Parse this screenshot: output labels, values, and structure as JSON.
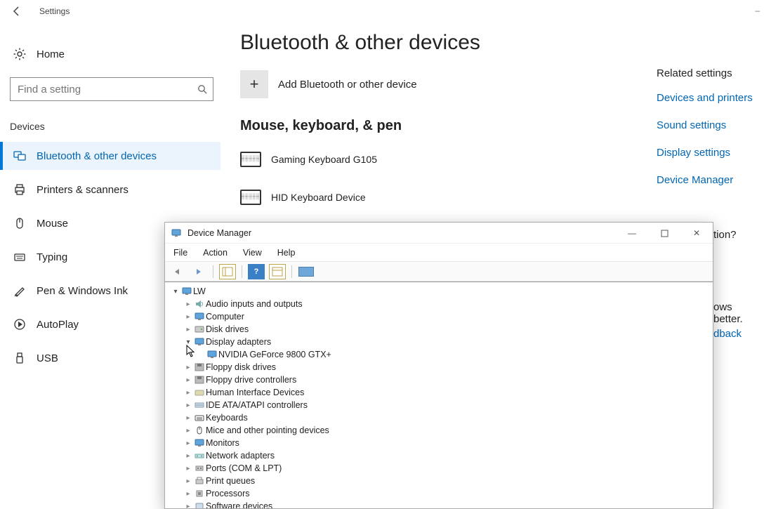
{
  "titlebar": {
    "label": "Settings"
  },
  "home": {
    "label": "Home"
  },
  "search": {
    "placeholder": "Find a setting"
  },
  "nav_group_label": "Devices",
  "nav": [
    {
      "label": "Bluetooth & other devices",
      "icon": "bluetooth-devices-icon"
    },
    {
      "label": "Printers & scanners",
      "icon": "printer-icon"
    },
    {
      "label": "Mouse",
      "icon": "mouse-icon"
    },
    {
      "label": "Typing",
      "icon": "typing-icon"
    },
    {
      "label": "Pen & Windows Ink",
      "icon": "pen-icon"
    },
    {
      "label": "AutoPlay",
      "icon": "autoplay-icon"
    },
    {
      "label": "USB",
      "icon": "usb-icon"
    }
  ],
  "main": {
    "page_title": "Bluetooth & other devices",
    "add_label": "Add Bluetooth or other device",
    "section1_title": "Mouse, keyboard, & pen",
    "devices": [
      {
        "label": "Gaming Keyboard G105"
      },
      {
        "label": "HID Keyboard Device"
      }
    ]
  },
  "rightcol": {
    "header": "Related settings",
    "links": [
      "Devices and printers",
      "Sound settings",
      "Display settings",
      "Device Manager"
    ]
  },
  "peek": {
    "question_tail": "tion?",
    "row1": "ows better.",
    "row2": "dback"
  },
  "dm": {
    "title": "Device Manager",
    "menus": [
      "File",
      "Action",
      "View",
      "Help"
    ],
    "root": "LW",
    "items": [
      {
        "label": "Audio inputs and outputs",
        "icon": "audio-icon"
      },
      {
        "label": "Computer",
        "icon": "computer-icon"
      },
      {
        "label": "Disk drives",
        "icon": "disk-icon"
      },
      {
        "label": "Display adapters",
        "icon": "display-icon",
        "expanded": true,
        "children": [
          {
            "label": "NVIDIA GeForce 9800 GTX+",
            "icon": "display-icon"
          }
        ]
      },
      {
        "label": "Floppy disk drives",
        "icon": "floppy-icon"
      },
      {
        "label": "Floppy drive controllers",
        "icon": "floppy-ctrl-icon"
      },
      {
        "label": "Human Interface Devices",
        "icon": "hid-icon"
      },
      {
        "label": "IDE ATA/ATAPI controllers",
        "icon": "ide-icon"
      },
      {
        "label": "Keyboards",
        "icon": "keyboard-icon"
      },
      {
        "label": "Mice and other pointing devices",
        "icon": "mouse-icon"
      },
      {
        "label": "Monitors",
        "icon": "monitor-icon"
      },
      {
        "label": "Network adapters",
        "icon": "network-icon"
      },
      {
        "label": "Ports (COM & LPT)",
        "icon": "ports-icon"
      },
      {
        "label": "Print queues",
        "icon": "printq-icon"
      },
      {
        "label": "Processors",
        "icon": "cpu-icon"
      },
      {
        "label": "Software devices",
        "icon": "software-icon"
      }
    ]
  }
}
